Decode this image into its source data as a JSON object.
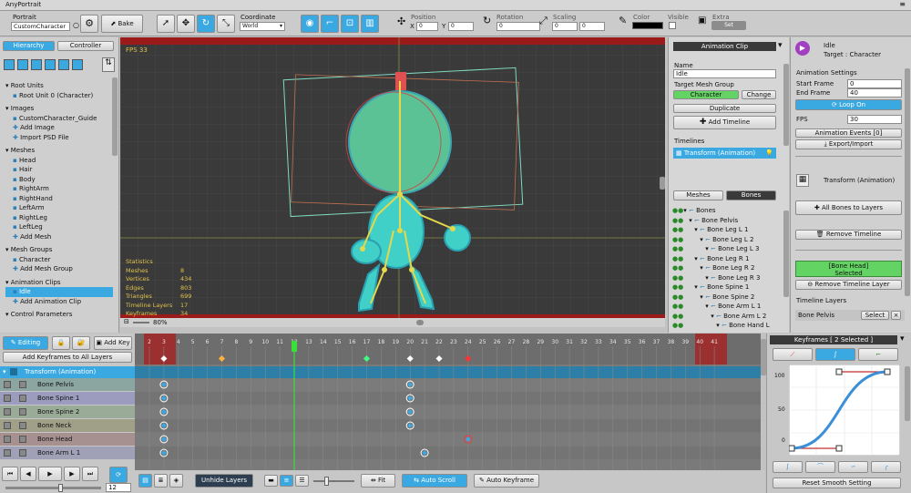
{
  "window": {
    "title": "AnyPortrait"
  },
  "toolbar": {
    "portrait_label": "Portrait",
    "portrait_value": "CustomCharacter",
    "bake_label": "Bake",
    "coordinate_label": "Coordinate",
    "coordinate_value": "World",
    "position_label": "Position",
    "x_label": "X",
    "x_value": "0",
    "y_label": "Y",
    "y_value": "0",
    "rotation_label": "Rotation",
    "rotation_value": "0",
    "scaling_label": "Scaling",
    "scale_x": "0",
    "scale_y": "0",
    "color_label": "Color",
    "visible_label": "Visible",
    "extra_label": "Extra",
    "set_label": "Set"
  },
  "left_panel": {
    "tab_hierarchy": "Hierarchy",
    "tab_controller": "Controller",
    "sections": [
      {
        "title": "Root Units",
        "items": [
          "Root Unit 0 (Character)"
        ]
      },
      {
        "title": "Images",
        "items": [
          "CustomCharacter_Guide",
          "Add Image",
          "Import PSD File"
        ]
      },
      {
        "title": "Meshes",
        "items": [
          "Head",
          "Hair",
          "Body",
          "RightArm",
          "RightHand",
          "LeftArm",
          "RightLeg",
          "LeftLeg",
          "Add Mesh"
        ]
      },
      {
        "title": "Mesh Groups",
        "items": [
          "Character",
          "Add Mesh Group"
        ]
      },
      {
        "title": "Animation Clips",
        "items": [
          "Idle",
          "Add Animation Clip"
        ]
      },
      {
        "title": "Control Parameters",
        "items": []
      }
    ]
  },
  "viewport": {
    "fps": "FPS 33",
    "zoom": "80%",
    "stats_title": "Statistics",
    "stats": [
      [
        "Meshes",
        "8"
      ],
      [
        "Vertices",
        "434"
      ],
      [
        "Edges",
        "803"
      ],
      [
        "Triangles",
        "699"
      ],
      [
        "Timeline Layers",
        "17"
      ],
      [
        "Keyframes",
        "34"
      ]
    ]
  },
  "clip_panel": {
    "header": "Animation Clip",
    "name_label": "Name",
    "name_value": "Idle",
    "target_label": "Target Mesh Group",
    "target_value": "Character",
    "change_label": "Change",
    "duplicate_label": "Duplicate",
    "add_timeline_label": "Add Timeline",
    "timelines_label": "Timelines",
    "timeline_item": "Transform (Animation)",
    "tab_meshes": "Meshes",
    "tab_bones": "Bones",
    "bones": [
      "Bones",
      "Bone Pelvis",
      "Bone Leg L 1",
      "Bone Leg L 2",
      "Bone Leg L 3",
      "Bone Leg R 1",
      "Bone Leg R 2",
      "Bone Leg R 3",
      "Bone Spine 1",
      "Bone Spine 2",
      "Bone Arm L 1",
      "Bone Arm L 2",
      "Bone Hand L"
    ]
  },
  "right_panel": {
    "clip_name": "Idle",
    "clip_target": "Target : Character",
    "settings_label": "Animation Settings",
    "start_frame_label": "Start Frame",
    "start_frame_value": "0",
    "end_frame_label": "End Frame",
    "end_frame_value": "40",
    "loop_label": "Loop On",
    "fps_label": "FPS",
    "fps_value": "30",
    "events_label": "Animation Events [0]",
    "export_label": "Export/Import",
    "timeline_title": "Transform (Animation)",
    "all_bones_label": "All Bones to Layers",
    "remove_timeline_label": "Remove Timeline",
    "selected_line1": "[Bone Head]",
    "selected_line2": "Selected",
    "remove_layer_label": "Remove Timeline Layer",
    "layers_label": "Timeline Layers",
    "layer_value": "Bone Pelvis",
    "select_label": "Select",
    "close_label": "×"
  },
  "timeline": {
    "editing_label": "Editing",
    "add_key_label": "Add Key",
    "add_all_label": "Add Keyframes to All Layers",
    "frame_numbers": [
      "2",
      "3",
      "4",
      "5",
      "6",
      "7",
      "8",
      "9",
      "10",
      "11",
      "12",
      "13",
      "14",
      "15",
      "16",
      "17",
      "18",
      "19",
      "20",
      "21",
      "22",
      "23",
      "24",
      "25",
      "26",
      "27",
      "28",
      "29",
      "30",
      "31",
      "32",
      "33",
      "34",
      "35",
      "36",
      "37",
      "38",
      "39",
      "40",
      "41"
    ],
    "group_label": "Transform (Animation)",
    "layers": [
      "Bone Pelvis",
      "Bone Spine 1",
      "Bone Spine 2",
      "Bone Neck",
      "Bone Head",
      "Bone Arm L 1"
    ],
    "layer_colors": [
      "#8ba6a0",
      "#9c9cbf",
      "#9aac97",
      "#a0a089",
      "#a79090",
      "#a0a0b6"
    ],
    "current_frame": "12",
    "unhide_label": "Unhide Layers",
    "fit_label": "Fit",
    "auto_scroll_label": "Auto Scroll",
    "auto_keyframe_label": "Auto Keyframe"
  },
  "curve_panel": {
    "header": "Keyframes [ 2 Selected ]",
    "axis_100": "100",
    "axis_50": "50",
    "axis_0": "0",
    "reset_label": "Reset Smooth Setting"
  },
  "colors": {
    "accent": "#3aa9e2",
    "selected": "#63d363",
    "timeline_bg": "#7a7a7a"
  }
}
